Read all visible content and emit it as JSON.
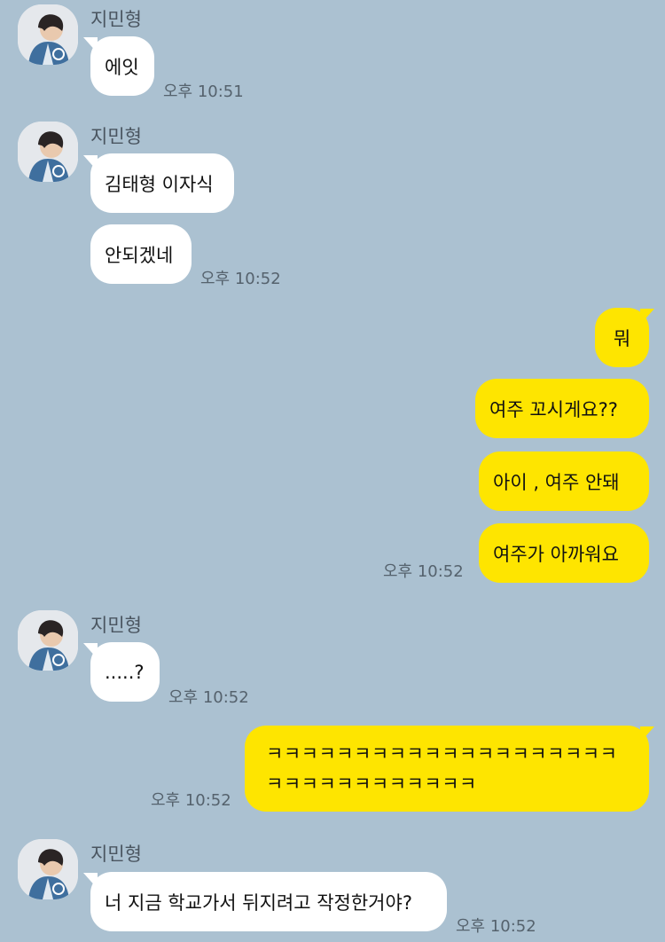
{
  "groups": [
    {
      "sender": "지민형",
      "messages": [
        "에잇"
      ],
      "time": "오후 10:51"
    },
    {
      "sender": "지민형",
      "messages": [
        "김태형 이자식",
        "안되겠네"
      ],
      "time": "오후 10:52"
    },
    {
      "sender": "me",
      "messages": [
        "뭐",
        "여주 꼬시게요??",
        "아이 , 여주 안돼",
        "여주가 아까워요"
      ],
      "time": "오후 10:52"
    },
    {
      "sender": "지민형",
      "messages": [
        ".....?"
      ],
      "time": "오후 10:52"
    },
    {
      "sender": "me",
      "messages": [
        "ㅋㅋㅋㅋㅋㅋㅋㅋㅋㅋㅋㅋㅋㅋㅋㅋㅋㅋㅋㅋㅋㅋㅋㅋㅋㅋㅋㅋㅋㅋㅋㅋ"
      ],
      "time": "오후 10:52"
    },
    {
      "sender": "지민형",
      "messages": [
        "너 지금 학교가서 뒤지려고 작정한거야?"
      ],
      "time": "오후 10:52"
    }
  ],
  "colors": {
    "background": "#abc1d1",
    "incoming_bubble": "#ffffff",
    "outgoing_bubble": "#fee500"
  }
}
